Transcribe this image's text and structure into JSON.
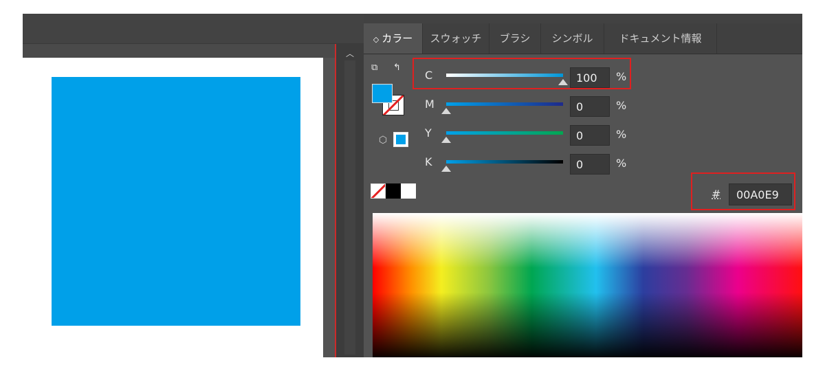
{
  "panel": {
    "tabs": [
      {
        "label": "カラー",
        "active": true
      },
      {
        "label": "スウォッチ"
      },
      {
        "label": "ブラシ"
      },
      {
        "label": "シンボル"
      },
      {
        "label": "ドキュメント情報"
      }
    ]
  },
  "color": {
    "fill_hex": "#00A0E9",
    "sliders": [
      {
        "label": "C",
        "value": "100",
        "unit": "%",
        "level": 1.0
      },
      {
        "label": "M",
        "value": "0",
        "unit": "%",
        "level": 0.0
      },
      {
        "label": "Y",
        "value": "0",
        "unit": "%",
        "level": 0.0
      },
      {
        "label": "K",
        "value": "0",
        "unit": "%",
        "level": 0.0
      }
    ],
    "hex_label": "#",
    "hex_value": "00A0E9",
    "highlight_color": "#E02020"
  },
  "icons": {
    "swap": "swap-icon",
    "default_colors": "default-fill-stroke-icon",
    "cube": "color-mode-cube-icon",
    "scroll_up": "chevron-up-icon"
  }
}
